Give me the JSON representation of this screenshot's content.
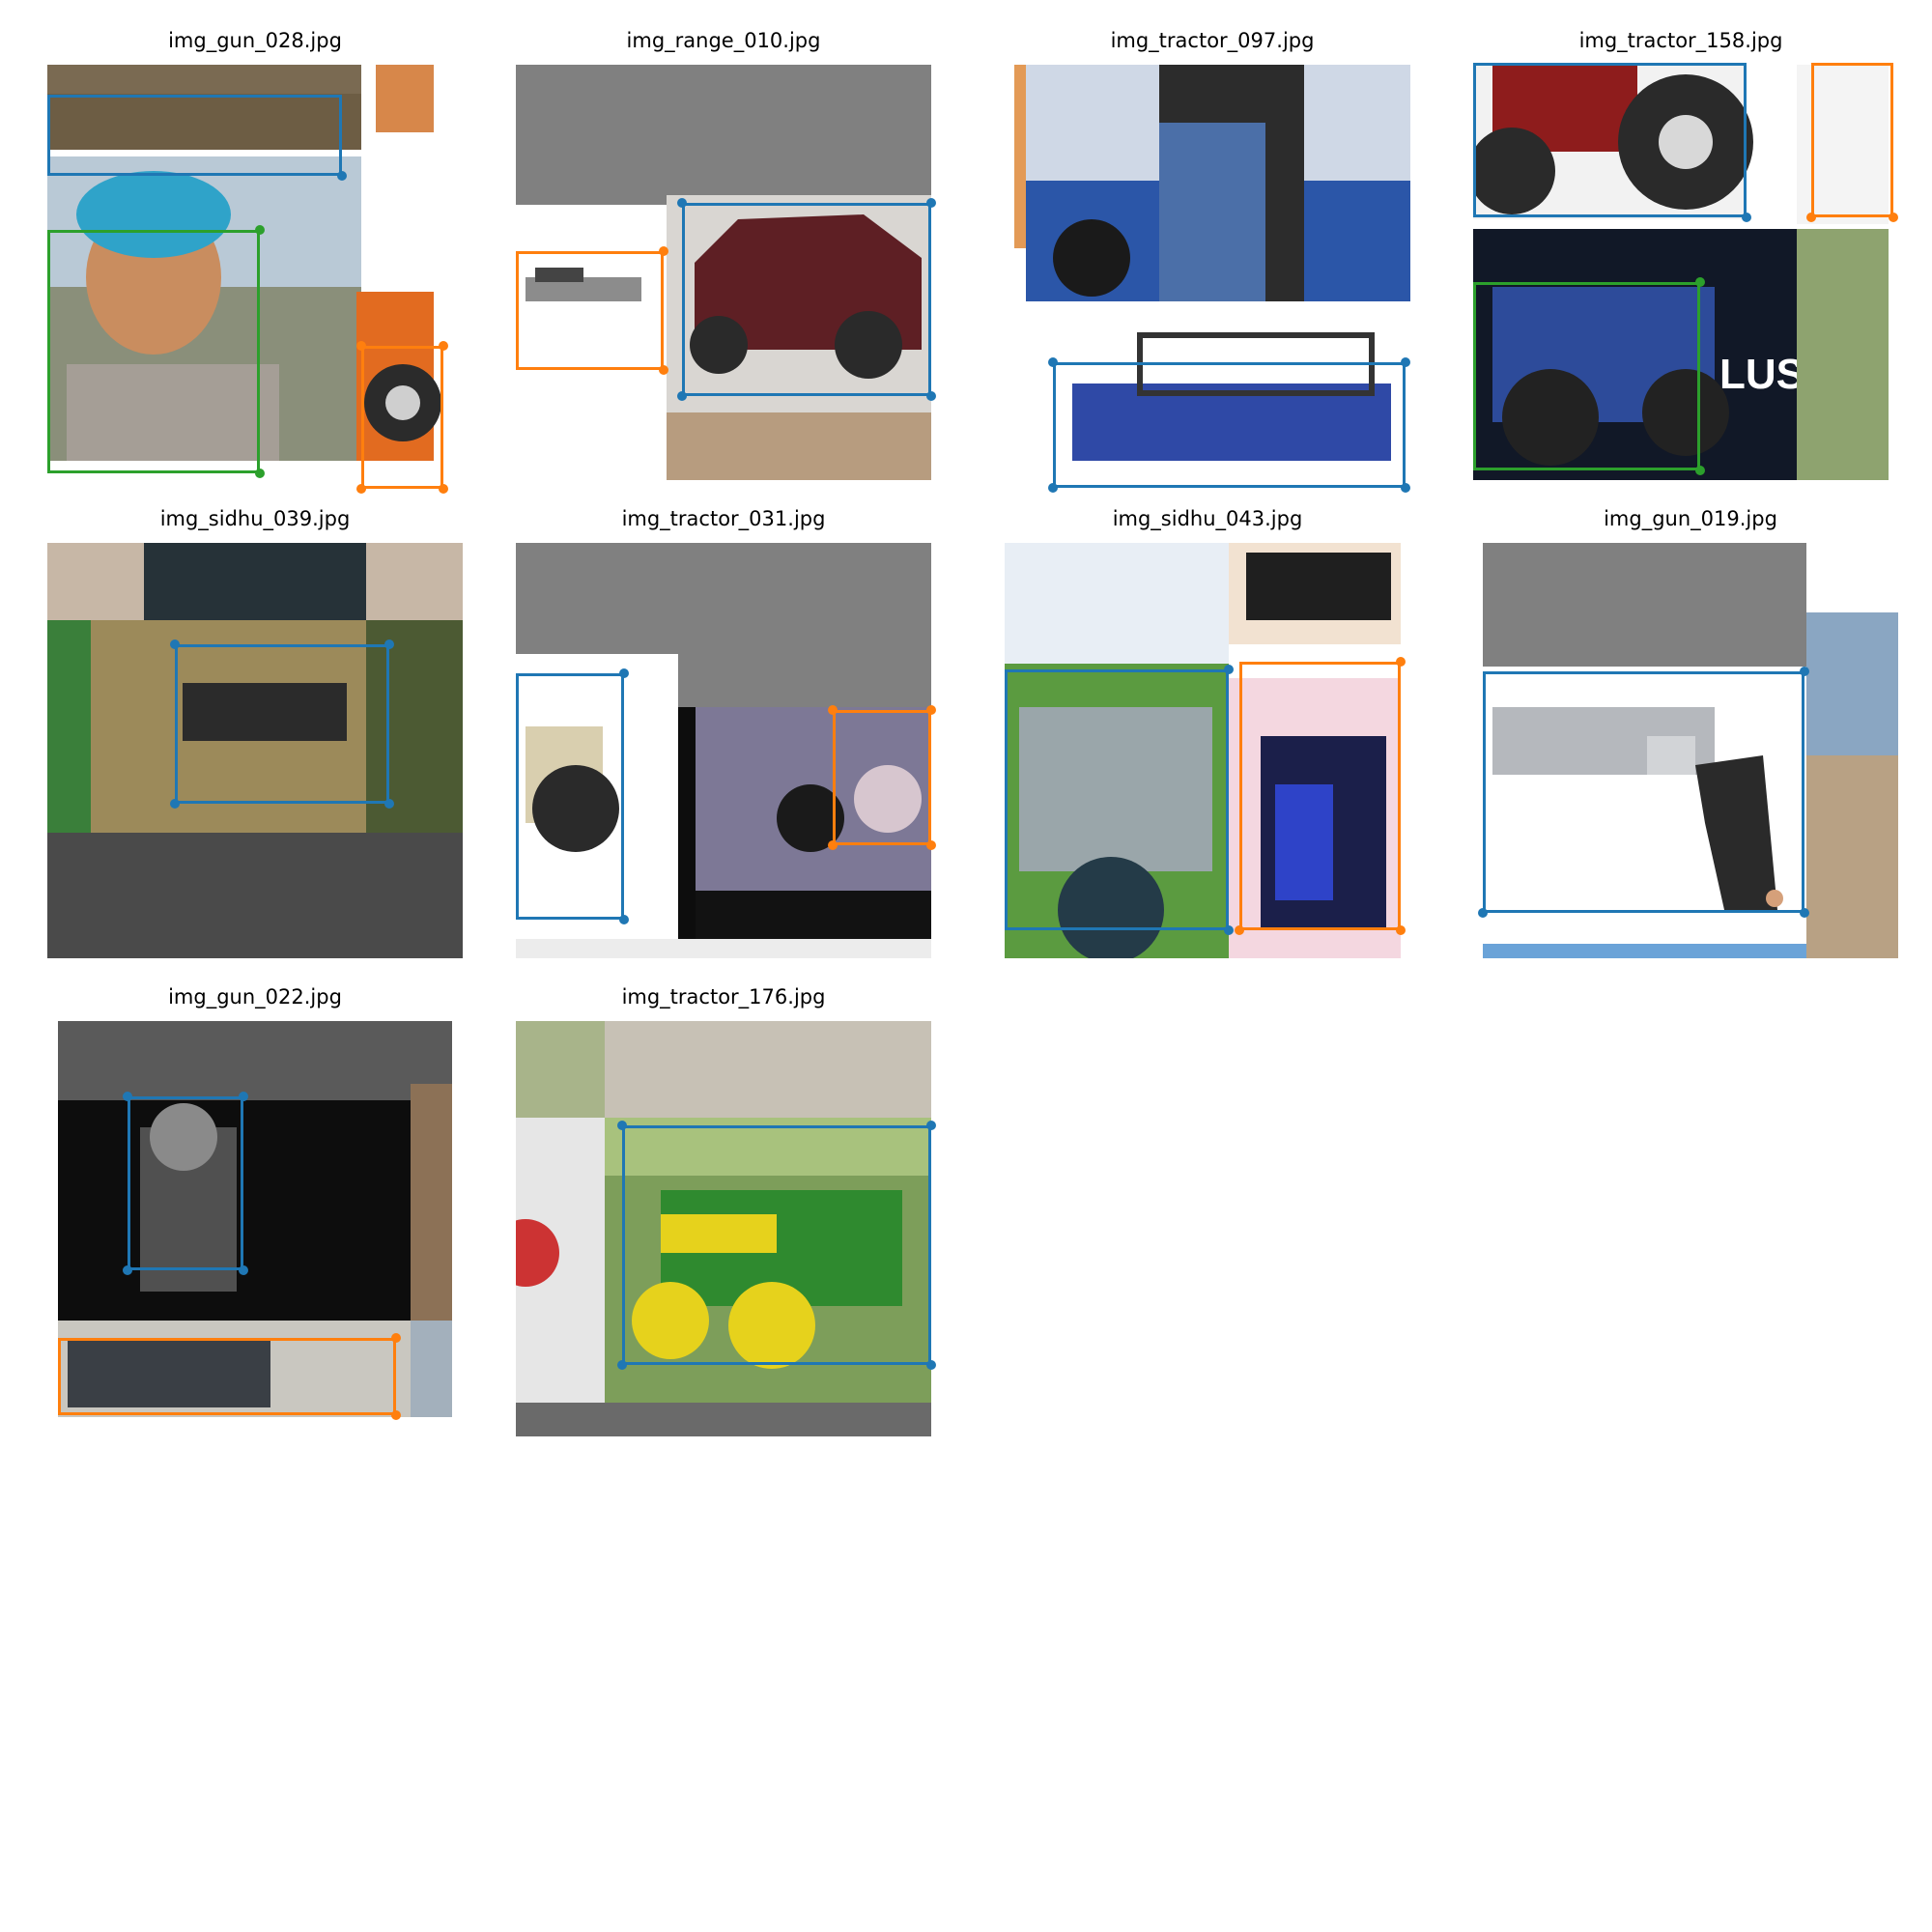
{
  "grid": {
    "panels": [
      {
        "title": "img_gun_028.jpg"
      },
      {
        "title": "img_range_010.jpg"
      },
      {
        "title": "img_tractor_097.jpg"
      },
      {
        "title": "img_tractor_158.jpg"
      },
      {
        "title": "img_sidhu_039.jpg"
      },
      {
        "title": "img_tractor_031.jpg"
      },
      {
        "title": "img_sidhu_043.jpg"
      },
      {
        "title": "img_gun_019.jpg"
      },
      {
        "title": "img_gun_022.jpg"
      },
      {
        "title": "img_tractor_176.jpg"
      }
    ]
  },
  "colors": {
    "box_blue": "#1f77b4",
    "box_orange": "#ff7f0e",
    "box_green": "#2ca02c"
  }
}
